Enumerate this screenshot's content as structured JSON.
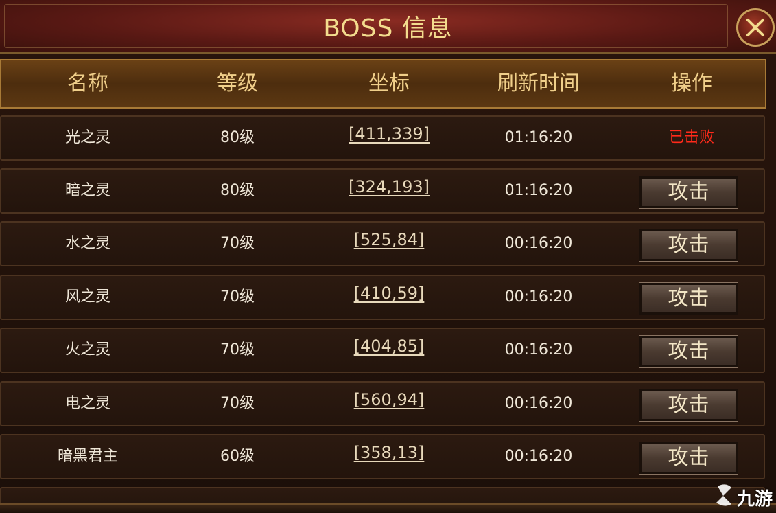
{
  "window": {
    "title": "BOSS 信息"
  },
  "table": {
    "headers": [
      "名称",
      "等级",
      "坐标",
      "刷新时间",
      "操作"
    ],
    "rows": [
      {
        "name": "光之灵",
        "level": "80级",
        "coord": "[411,339]",
        "refresh": "01:16:20",
        "action": "已击败",
        "defeated": true
      },
      {
        "name": "暗之灵",
        "level": "80级",
        "coord": "[324,193]",
        "refresh": "01:16:20",
        "action": "攻击",
        "defeated": false
      },
      {
        "name": "水之灵",
        "level": "70级",
        "coord": "[525,84]",
        "refresh": "00:16:20",
        "action": "攻击",
        "defeated": false
      },
      {
        "name": "风之灵",
        "level": "70级",
        "coord": "[410,59]",
        "refresh": "00:16:20",
        "action": "攻击",
        "defeated": false
      },
      {
        "name": "火之灵",
        "level": "70级",
        "coord": "[404,85]",
        "refresh": "00:16:20",
        "action": "攻击",
        "defeated": false
      },
      {
        "name": "电之灵",
        "level": "70级",
        "coord": "[560,94]",
        "refresh": "00:16:20",
        "action": "攻击",
        "defeated": false
      },
      {
        "name": "暗黑君主",
        "level": "60级",
        "coord": "[358,13]",
        "refresh": "00:16:20",
        "action": "攻击",
        "defeated": false
      }
    ]
  },
  "watermark": {
    "text": "九游"
  },
  "icons": {
    "close": "close-icon",
    "watermark_logo": "jiuyou-logo-icon"
  },
  "colors": {
    "title": "#f3dc8e",
    "header_text": "#f0cf8a",
    "defeated": "#ff2a1a",
    "row_bg": "#2c1a10"
  }
}
